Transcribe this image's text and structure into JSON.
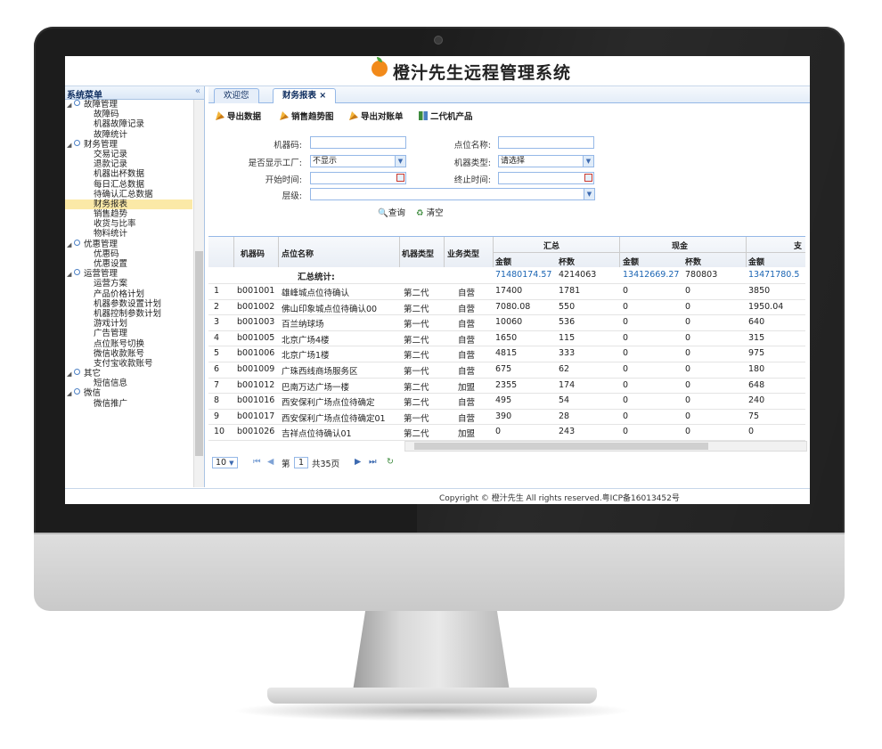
{
  "app": {
    "title": "橙汁先生远程管理系统",
    "copyright": "Copyright © 橙汁先生 All rights reserved.粤ICP备16013452号"
  },
  "sidebar": {
    "title": "系统菜单",
    "collapse_icon": "«",
    "items": [
      {
        "label": "故障管理",
        "type": "group"
      },
      {
        "label": "故障码",
        "type": "leaf"
      },
      {
        "label": "机器故障记录",
        "type": "leaf"
      },
      {
        "label": "故障统计",
        "type": "leaf"
      },
      {
        "label": "财务管理",
        "type": "group"
      },
      {
        "label": "交易记录",
        "type": "leaf"
      },
      {
        "label": "退款记录",
        "type": "leaf"
      },
      {
        "label": "机器出杯数据",
        "type": "leaf"
      },
      {
        "label": "每日汇总数据",
        "type": "leaf"
      },
      {
        "label": "待确认汇总数据",
        "type": "leaf"
      },
      {
        "label": "财务报表",
        "type": "leaf",
        "selected": true
      },
      {
        "label": "销售趋势",
        "type": "leaf"
      },
      {
        "label": "收货与比率",
        "type": "leaf"
      },
      {
        "label": "物料统计",
        "type": "leaf"
      },
      {
        "label": "优惠管理",
        "type": "group"
      },
      {
        "label": "优惠码",
        "type": "leaf"
      },
      {
        "label": "优惠设置",
        "type": "leaf"
      },
      {
        "label": "运营管理",
        "type": "group"
      },
      {
        "label": "运营方案",
        "type": "leaf"
      },
      {
        "label": "产品价格计划",
        "type": "leaf"
      },
      {
        "label": "机器参数设置计划",
        "type": "leaf"
      },
      {
        "label": "机器控制参数计划",
        "type": "leaf"
      },
      {
        "label": "游戏计划",
        "type": "leaf"
      },
      {
        "label": "广告管理",
        "type": "leaf"
      },
      {
        "label": "点位账号切换",
        "type": "leaf"
      },
      {
        "label": "微信收款账号",
        "type": "leaf"
      },
      {
        "label": "支付宝收款账号",
        "type": "leaf"
      },
      {
        "label": "其它",
        "type": "group"
      },
      {
        "label": "短信信息",
        "type": "leaf"
      },
      {
        "label": "微信",
        "type": "group"
      },
      {
        "label": "微信推广",
        "type": "leaf"
      }
    ]
  },
  "tabs": [
    {
      "label": "欢迎您"
    },
    {
      "label": "财务报表 ×",
      "active": true
    }
  ],
  "toolbar": {
    "export_data": "导出数据",
    "sales_trend": "销售趋势图",
    "export_reconcile": "导出对账单",
    "second_gen": "二代机产品"
  },
  "filters": {
    "machine_code_label": "机器码:",
    "machine_code_value": "",
    "show_factory_label": "是否显示工厂:",
    "show_factory_value": "不显示",
    "start_time_label": "开始时间:",
    "start_time_value": "",
    "level_label": "层级:",
    "level_value": "",
    "location_name_label": "点位名称:",
    "location_name_value": "",
    "machine_type_label": "机器类型:",
    "machine_type_value": "请选择",
    "end_time_label": "终止时间:",
    "end_time_value": "",
    "query_button": "查询",
    "clear_button": "清空"
  },
  "grid": {
    "headers": {
      "machine_code": "机器码",
      "location": "点位名称",
      "machine_type": "机器类型",
      "business_type": "业务类型",
      "group_total": "汇总",
      "group_cash": "现金",
      "group_pay": "支",
      "amount": "金额",
      "cups": "杯数"
    },
    "summary": {
      "label": "汇总统计:",
      "total_amount": "71480174.57",
      "total_cups": "4214063",
      "cash_amount": "13412669.27",
      "cash_cups": "780803",
      "pay_amount": "13471780.5"
    },
    "rows": [
      {
        "no": "1",
        "code": "b001001",
        "location": "雄峰城点位待确认",
        "mtype": "第二代",
        "btype": "自营",
        "amount": "17400",
        "cups": "1781",
        "cash_amount": "0",
        "cash_cups": "0",
        "pay_amount": "3850"
      },
      {
        "no": "2",
        "code": "b001002",
        "location": "佛山印象城点位待确认00",
        "mtype": "第二代",
        "btype": "自营",
        "amount": "7080.08",
        "cups": "550",
        "cash_amount": "0",
        "cash_cups": "0",
        "pay_amount": "1950.04"
      },
      {
        "no": "3",
        "code": "b001003",
        "location": "百兰纳球场",
        "mtype": "第一代",
        "btype": "自营",
        "amount": "10060",
        "cups": "536",
        "cash_amount": "0",
        "cash_cups": "0",
        "pay_amount": "640"
      },
      {
        "no": "4",
        "code": "b001005",
        "location": "北京广场4楼",
        "mtype": "第二代",
        "btype": "自营",
        "amount": "1650",
        "cups": "115",
        "cash_amount": "0",
        "cash_cups": "0",
        "pay_amount": "315"
      },
      {
        "no": "5",
        "code": "b001006",
        "location": "北京广场1楼",
        "mtype": "第二代",
        "btype": "自营",
        "amount": "4815",
        "cups": "333",
        "cash_amount": "0",
        "cash_cups": "0",
        "pay_amount": "975"
      },
      {
        "no": "6",
        "code": "b001009",
        "location": "广珠西线商场服务区",
        "mtype": "第一代",
        "btype": "自营",
        "amount": "675",
        "cups": "62",
        "cash_amount": "0",
        "cash_cups": "0",
        "pay_amount": "180"
      },
      {
        "no": "7",
        "code": "b001012",
        "location": "巴南万达广场一楼",
        "mtype": "第二代",
        "btype": "加盟",
        "amount": "2355",
        "cups": "174",
        "cash_amount": "0",
        "cash_cups": "0",
        "pay_amount": "648"
      },
      {
        "no": "8",
        "code": "b001016",
        "location": "西安保利广场点位待确定",
        "mtype": "第二代",
        "btype": "自营",
        "amount": "495",
        "cups": "54",
        "cash_amount": "0",
        "cash_cups": "0",
        "pay_amount": "240"
      },
      {
        "no": "9",
        "code": "b001017",
        "location": "西安保利广场点位待确定01",
        "mtype": "第一代",
        "btype": "自营",
        "amount": "390",
        "cups": "28",
        "cash_amount": "0",
        "cash_cups": "0",
        "pay_amount": "75"
      },
      {
        "no": "10",
        "code": "b001026",
        "location": "吉祥点位待确认01",
        "mtype": "第二代",
        "btype": "加盟",
        "amount": "0",
        "cups": "243",
        "cash_amount": "0",
        "cash_cups": "0",
        "pay_amount": "0"
      }
    ]
  },
  "pager": {
    "page_size": "10",
    "page_prefix": "第",
    "page_value": "1",
    "page_suffix": "共35页"
  },
  "colors": {
    "accent": "#95b8e7",
    "selected": "#fbe9a7",
    "link_blue": "#1a64b3",
    "logo": "#f28a1a"
  }
}
